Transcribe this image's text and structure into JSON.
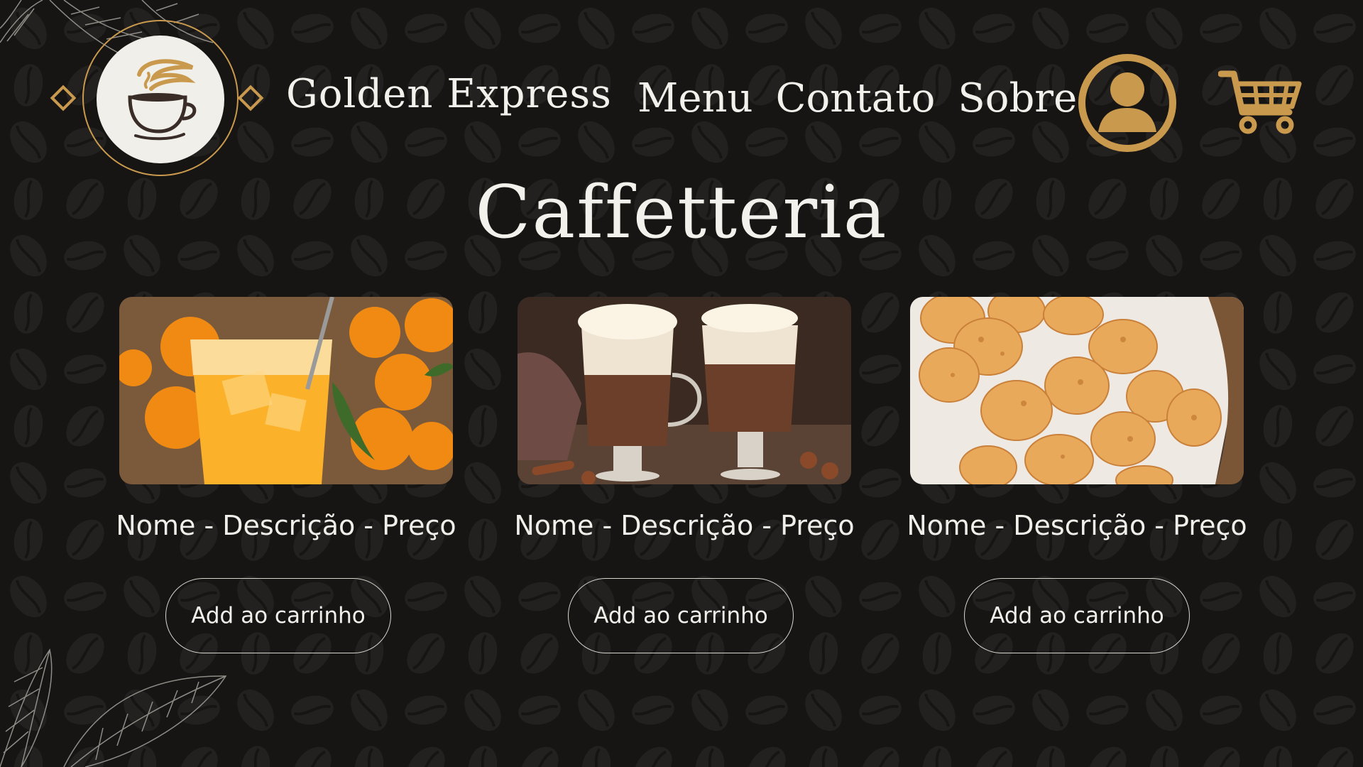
{
  "colors": {
    "background": "#161514",
    "accent_gold": "#c99a4e",
    "text": "#f3f1ec",
    "logo_disc": "#f1efea"
  },
  "header": {
    "brand_name": "Golden Express",
    "logo_icon": "coffee-cup-icon",
    "nav": [
      {
        "label": "Menu"
      },
      {
        "label": "Contato"
      },
      {
        "label": "Sobre"
      }
    ],
    "user_icon": "user-profile-icon",
    "cart_icon": "shopping-cart-icon"
  },
  "page": {
    "title": "Caffetteria"
  },
  "products": [
    {
      "image": "orange-juice-photo",
      "info": "Nome - Descrição - Preço",
      "button_label": "Add ao carrinho"
    },
    {
      "image": "hot-chocolate-photo",
      "info": "Nome - Descrição - Preço",
      "button_label": "Add ao carrinho"
    },
    {
      "image": "cheese-bread-photo",
      "info": "Nome - Descrição - Preço",
      "button_label": "Add ao carrinho"
    }
  ]
}
